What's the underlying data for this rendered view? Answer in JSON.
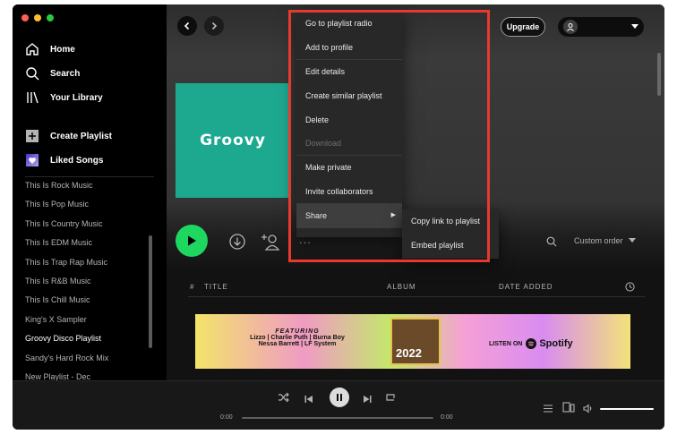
{
  "sidebar": {
    "nav": [
      {
        "label": "Home",
        "icon": "home-icon"
      },
      {
        "label": "Search",
        "icon": "search-icon"
      },
      {
        "label": "Your Library",
        "icon": "library-icon"
      }
    ],
    "actions": [
      {
        "label": "Create Playlist",
        "icon": "plus-icon"
      },
      {
        "label": "Liked Songs",
        "icon": "heart-icon"
      }
    ],
    "playlists": [
      "This Is Rock Music",
      "This Is Pop Music",
      "This Is Country Music",
      "This Is EDM Music",
      "This Is Trap Rap Music",
      "This Is R&B Music",
      "This Is Chill Music",
      "King's X Sampler",
      "Groovy Disco Playlist",
      "Sandy's Hard Rock Mix",
      "New Playlist - Dec"
    ],
    "active_playlist_index": 8
  },
  "header": {
    "upgrade_label": "Upgrade"
  },
  "playlist": {
    "cover_text": "Groovy",
    "cover_color": "#1da890"
  },
  "actions_bar": {
    "more_label": "...",
    "sort_label": "Custom order"
  },
  "table": {
    "columns": [
      "#",
      "TITLE",
      "ALBUM",
      "DATE ADDED"
    ]
  },
  "banner": {
    "featuring": "FEATURING",
    "artists_line1": "Lizzo | Charlie Puth | Burna Boy",
    "artists_line2": "Nessa Barrett | LF System",
    "art_year": "2022",
    "listen_on": "LISTEN ON",
    "brand": "Spotify"
  },
  "player": {
    "time_elapsed": "0:00",
    "time_total": "0:00"
  },
  "context_menu": {
    "items": [
      {
        "label": "Go to playlist radio",
        "disabled": false
      },
      {
        "label": "Add to profile",
        "disabled": false
      },
      {
        "label": "Edit details",
        "disabled": false
      },
      {
        "label": "Create similar playlist",
        "disabled": false
      },
      {
        "label": "Delete",
        "disabled": false
      },
      {
        "label": "Download",
        "disabled": true
      },
      {
        "label": "Make private",
        "disabled": false
      },
      {
        "label": "Invite collaborators",
        "disabled": false
      },
      {
        "label": "Share",
        "disabled": false,
        "has_submenu": true,
        "highlighted": true
      }
    ],
    "submenu": [
      "Copy link to playlist",
      "Embed playlist"
    ]
  },
  "colors": {
    "accent": "#1ed760",
    "highlight_box": "#e8392f"
  }
}
